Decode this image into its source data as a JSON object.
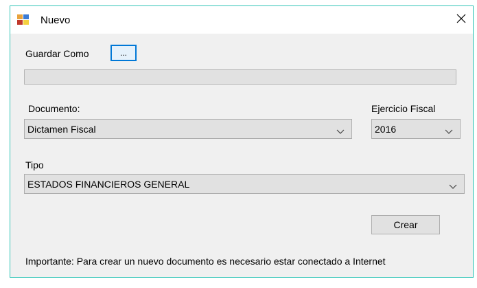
{
  "window": {
    "title": "Nuevo",
    "border_color": "#2ec4b6",
    "icon": "app-window-icon",
    "close_icon": "close-icon"
  },
  "guardar": {
    "label": "Guardar Como",
    "browse_label": "...",
    "path_value": ""
  },
  "documento": {
    "label": "Documento:",
    "selected": "Dictamen Fiscal",
    "icon": "chevron-down-icon"
  },
  "ejercicio": {
    "label": "Ejercicio Fiscal",
    "selected": "2016",
    "icon": "chevron-down-icon"
  },
  "tipo": {
    "label": "Tipo",
    "selected": "ESTADOS FINANCIEROS GENERAL",
    "icon": "chevron-down-icon"
  },
  "actions": {
    "crear_label": "Crear",
    "focus_color": "#0078d7"
  },
  "notice": {
    "text": "Importante: Para crear un nuevo documento es necesario estar conectado a Internet"
  }
}
